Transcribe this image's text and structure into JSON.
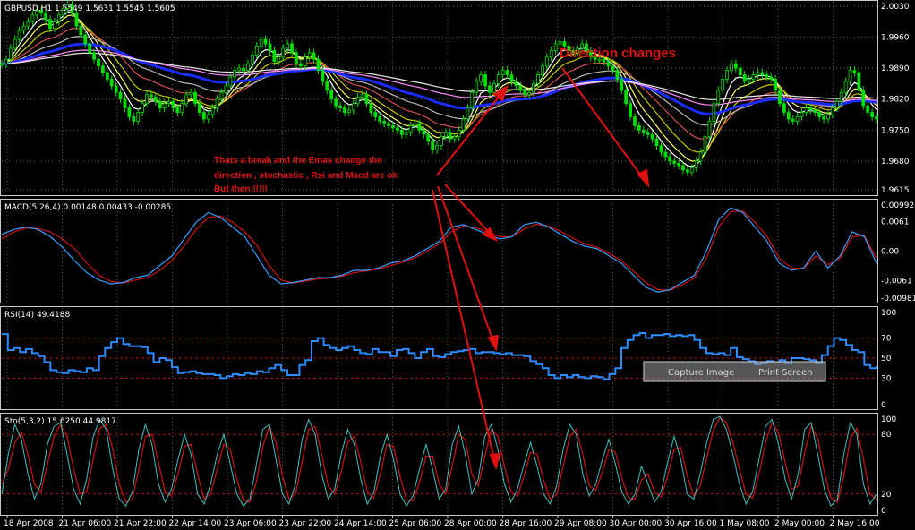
{
  "chart_data": {
    "type": "line",
    "price_panel": {
      "label": "GBPUSD,H1  1.5549 1.5631 1.5545 1.5605",
      "scale_labels": [
        "2.0030",
        "1.9960",
        "1.9890",
        "1.9820",
        "1.9750",
        "1.9680",
        "1.9615"
      ],
      "ylim": [
        1.9605,
        2.004
      ],
      "close": [
        1.99,
        1.991,
        1.9935,
        1.9955,
        1.9975,
        1.9985,
        1.9995,
        2.001,
        2.002,
        2.0015,
        2.0,
        1.998,
        1.9995,
        2.001,
        2.0025,
        2.0035,
        2.0015,
        1.9985,
        1.9965,
        1.9945,
        1.9925,
        1.991,
        1.9895,
        1.988,
        1.9865,
        1.985,
        1.9835,
        1.982,
        1.98,
        1.978,
        1.977,
        1.979,
        1.981,
        1.983,
        1.9825,
        1.9815,
        1.98,
        1.981,
        1.9815,
        1.98,
        1.979,
        1.981,
        1.983,
        1.9835,
        1.981,
        1.979,
        1.9775,
        1.9785,
        1.98,
        1.982,
        1.9835,
        1.985,
        1.987,
        1.9885,
        1.989,
        1.9885,
        1.99,
        1.992,
        1.994,
        1.9955,
        1.9945,
        1.993,
        1.9905,
        1.9915,
        1.9935,
        1.9945,
        1.9925,
        1.99,
        1.9895,
        1.9915,
        1.9925,
        1.991,
        1.9885,
        1.986,
        1.984,
        1.982,
        1.9805,
        1.98,
        1.979,
        1.9795,
        1.981,
        1.9825,
        1.983,
        1.981,
        1.979,
        1.978,
        1.977,
        1.9765,
        1.976,
        1.9755,
        1.975,
        1.974,
        1.9745,
        1.976,
        1.9765,
        1.975,
        1.974,
        1.9725,
        1.9705,
        1.9715,
        1.9735,
        1.9745,
        1.973,
        1.9735,
        1.975,
        1.9775,
        1.98,
        1.9835,
        1.986,
        1.9875,
        1.985,
        1.9835,
        1.9855,
        1.9875,
        1.9885,
        1.9875,
        1.986,
        1.985,
        1.984,
        1.983,
        1.9835,
        1.9855,
        1.9875,
        1.9895,
        1.9915,
        1.993,
        1.9945,
        1.995,
        1.994,
        1.993,
        1.9925,
        1.9935,
        1.9945,
        1.993,
        1.9915,
        1.991,
        1.991,
        1.9905,
        1.9895,
        1.9885,
        1.9865,
        1.984,
        1.981,
        1.978,
        1.976,
        1.975,
        1.9745,
        1.974,
        1.973,
        1.9715,
        1.97,
        1.969,
        1.968,
        1.9675,
        1.967,
        1.966,
        1.9655,
        1.9665,
        1.968,
        1.97,
        1.9735,
        1.977,
        1.981,
        1.984,
        1.9865,
        1.9885,
        1.99,
        1.989,
        1.9875,
        1.986,
        1.9865,
        1.9875,
        1.988,
        1.9875,
        1.987,
        1.9865,
        1.984,
        1.981,
        1.979,
        1.9775,
        1.977,
        1.978,
        1.979,
        1.98,
        1.9795,
        1.979,
        1.978,
        1.9775,
        1.9785,
        1.98,
        1.9815,
        1.9835,
        1.986,
        1.9885,
        1.988,
        1.984,
        1.9805,
        1.979,
        1.978,
        1.9775
      ]
    },
    "macd_panel": {
      "label": "MACD(5,26,4) 0.00148 0.00433 -0.00285",
      "scale_labels": [
        "0.00992",
        "0.0061",
        "0.00",
        "-0.0061",
        "-0.00981"
      ],
      "ylim": [
        -0.0105,
        0.0105
      ],
      "macd": [
        0.0035,
        0.0045,
        0.005,
        0.0045,
        0.003,
        0.0008,
        -0.002,
        -0.0045,
        -0.006,
        -0.0068,
        -0.0065,
        -0.0055,
        -0.005,
        -0.003,
        -0.001,
        0.0025,
        0.006,
        0.008,
        0.007,
        0.005,
        0.003,
        -0.001,
        -0.005,
        -0.0068,
        -0.0065,
        -0.006,
        -0.0055,
        -0.0055,
        -0.005,
        -0.004,
        -0.004,
        -0.0035,
        -0.0025,
        -0.002,
        -0.001,
        0.0005,
        0.002,
        0.005,
        0.0055,
        0.0045,
        0.0035,
        0.0025,
        0.003,
        0.0055,
        0.006,
        0.005,
        0.0035,
        0.002,
        0.001,
        0.0005,
        -0.001,
        -0.0025,
        -0.005,
        -0.0075,
        -0.0085,
        -0.008,
        -0.0065,
        -0.005,
        0.0,
        0.0065,
        0.009,
        0.008,
        0.005,
        0.002,
        -0.0025,
        -0.004,
        -0.0035,
        0.0,
        -0.0035,
        -0.001,
        0.004,
        0.003,
        -0.0025
      ],
      "signal": [
        0.0025,
        0.004,
        0.0048,
        0.0047,
        0.004,
        0.0025,
        0.0005,
        -0.0025,
        -0.005,
        -0.0063,
        -0.0066,
        -0.006,
        -0.0055,
        -0.004,
        -0.002,
        0.001,
        0.0045,
        0.007,
        0.0073,
        0.006,
        0.004,
        0.0012,
        -0.003,
        -0.006,
        -0.0066,
        -0.0062,
        -0.0058,
        -0.0056,
        -0.0052,
        -0.0045,
        -0.0041,
        -0.0037,
        -0.003,
        -0.0023,
        -0.0014,
        0.0,
        0.0015,
        0.004,
        0.0052,
        0.0049,
        0.004,
        0.003,
        0.003,
        0.0046,
        0.0056,
        0.0052,
        0.0041,
        0.0027,
        0.0015,
        0.0008,
        -0.0005,
        -0.002,
        -0.0042,
        -0.0065,
        -0.008,
        -0.0081,
        -0.007,
        -0.0056,
        -0.0015,
        0.005,
        0.0082,
        0.0083,
        0.006,
        0.003,
        -0.0015,
        -0.0035,
        -0.0036,
        -0.001,
        -0.0028,
        -0.0015,
        0.003,
        0.0032,
        -0.0015
      ]
    },
    "rsi_panel": {
      "label": "RSI(14) 49.4188",
      "scale_labels": [
        "100",
        "70",
        "50",
        "30",
        "0"
      ],
      "levels": [
        70,
        50,
        30
      ],
      "ylim": [
        0,
        100
      ],
      "values": [
        74,
        58,
        60,
        56,
        59,
        55,
        52,
        46,
        38,
        36,
        35,
        38,
        37,
        36,
        40,
        38,
        52,
        60,
        66,
        70,
        64,
        62,
        62,
        61,
        55,
        46,
        50,
        48,
        41,
        35,
        36,
        37,
        35,
        34,
        34,
        33,
        30,
        32,
        34,
        33,
        35,
        34,
        37,
        36,
        40,
        43,
        38,
        33,
        33,
        43,
        48,
        67,
        70,
        63,
        60,
        58,
        60,
        62,
        58,
        55,
        54,
        59,
        56,
        56,
        52,
        58,
        59,
        55,
        50,
        56,
        59,
        52,
        51,
        54,
        56,
        57,
        58,
        59,
        55,
        56,
        56,
        55,
        54,
        55,
        53,
        53,
        52,
        47,
        44,
        40,
        33,
        30,
        33,
        31,
        33,
        31,
        30,
        32,
        31,
        29,
        34,
        40,
        60,
        68,
        73,
        75,
        70,
        73,
        73,
        74,
        72,
        73,
        72,
        73,
        68,
        60,
        55,
        54,
        55,
        53,
        60,
        51,
        49,
        47,
        44,
        45,
        47,
        46,
        48,
        45,
        50,
        50,
        49,
        48,
        45,
        53,
        62,
        70,
        68,
        63,
        58,
        56,
        43,
        40,
        42
      ]
    },
    "sto_panel": {
      "label": "Sto(5,3,2) 15.6250 44.9817",
      "scale_labels": [
        "100",
        "80",
        "20",
        "0"
      ],
      "levels": [
        80,
        20
      ],
      "ylim": [
        0,
        100
      ],
      "main": [
        20,
        60,
        90,
        75,
        40,
        15,
        30,
        70,
        88,
        92,
        60,
        25,
        10,
        35,
        78,
        95,
        85,
        45,
        15,
        8,
        22,
        65,
        90,
        70,
        30,
        12,
        25,
        55,
        80,
        60,
        20,
        10,
        30,
        60,
        80,
        50,
        20,
        8,
        15,
        50,
        85,
        90,
        55,
        20,
        10,
        30,
        75,
        95,
        80,
        40,
        15,
        25,
        60,
        85,
        70,
        35,
        10,
        22,
        58,
        80,
        55,
        20,
        8,
        18,
        45,
        70,
        45,
        15,
        25,
        70,
        88,
        60,
        20,
        35,
        78,
        90,
        65,
        30,
        12,
        25,
        50,
        72,
        48,
        20,
        10,
        28,
        65,
        90,
        80,
        40,
        18,
        30,
        55,
        75,
        50,
        22,
        10,
        20,
        48,
        30,
        12,
        22,
        52,
        78,
        55,
        20,
        15,
        40,
        72,
        95,
        98,
        85,
        60,
        30,
        10,
        22,
        55,
        88,
        95,
        70,
        35,
        15,
        40,
        85,
        92,
        60,
        25,
        8,
        15,
        60,
        92,
        80,
        30,
        10,
        20
      ],
      "signal": [
        30,
        45,
        72,
        82,
        60,
        30,
        22,
        50,
        78,
        90,
        78,
        45,
        20,
        22,
        55,
        86,
        90,
        65,
        30,
        12,
        15,
        45,
        78,
        80,
        52,
        22,
        18,
        40,
        68,
        70,
        40,
        15,
        20,
        45,
        70,
        65,
        35,
        14,
        12,
        32,
        68,
        88,
        72,
        38,
        15,
        20,
        52,
        85,
        88,
        60,
        28,
        20,
        42,
        72,
        78,
        52,
        22,
        16,
        40,
        70,
        68,
        38,
        14,
        13,
        32,
        58,
        58,
        30,
        20,
        48,
        80,
        75,
        40,
        28,
        58,
        85,
        78,
        48,
        22,
        18,
        38,
        62,
        60,
        34,
        15,
        19,
        48,
        78,
        85,
        60,
        28,
        24,
        42,
        65,
        62,
        36,
        16,
        15,
        34,
        40,
        22,
        17,
        38,
        65,
        67,
        38,
        18,
        28,
        56,
        84,
        97,
        92,
        72,
        45,
        20,
        16,
        40,
        72,
        92,
        82,
        52,
        25,
        28,
        62,
        88,
        76,
        42,
        16,
        12,
        38,
        76,
        86,
        55,
        20,
        15
      ]
    },
    "time_labels": [
      "18 Apr 2008",
      "21 Apr 06:00",
      "21 Apr 22:00",
      "22 Apr 14:00",
      "23 Apr 06:00",
      "23 Apr 22:00",
      "24 Apr 14:00",
      "25 Apr 06:00",
      "28 Apr 00:00",
      "28 Apr 16:00",
      "29 Apr 08:00",
      "30 Apr 00:00",
      "30 Apr 16:00",
      "1 May 08:00",
      "2 May 00:00",
      "2 May 16:00"
    ]
  },
  "annotations": {
    "direction_changes": "Direction changes",
    "note_line1": "Thats a break and the Emas change the",
    "note_line2": "direction , stochastic , Rsi and Macd are ok",
    "note_line3": "But then !!!!!",
    "arrow_color": "#e01010"
  },
  "overlay": {
    "capture_image": "Capture Image",
    "print_screen": "Print Screen"
  },
  "colors": {
    "background": "#000000",
    "grid": "#5a5a5a",
    "candle_bull": "#00e000",
    "ema_blue": "#1a2cff",
    "ema_pink": "#ff8cff",
    "ema_white": "#e8e8e8",
    "macd_main": "#3a9cff",
    "macd_signal": "#d01010",
    "rsi_line": "#2c8cff",
    "level_line": "#b01818",
    "sto_main": "#40c0c0",
    "sto_signal": "#d01010"
  }
}
